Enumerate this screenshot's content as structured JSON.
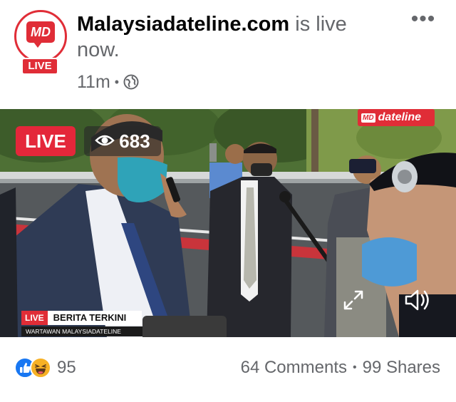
{
  "post": {
    "avatar_logo": "MD",
    "avatar_badge": "LIVE",
    "page_name": "Malaysiadateline.com",
    "status_text": "is live now.",
    "timestamp": "11m",
    "separator": "•",
    "audience_icon": "globe-icon",
    "more_label": "•••"
  },
  "video": {
    "live_label": "LIVE",
    "viewer_count": "683",
    "viewer_icon": "eye-icon",
    "watermark_logo": "MD",
    "watermark_text": "dateline",
    "lower_third": {
      "live": "LIVE",
      "title": "BERITA TERKINI",
      "subtitle": "WARTAWAN MALAYSIADATELINE"
    },
    "expand_icon": "expand-icon",
    "sound_icon": "speaker-icon"
  },
  "footer": {
    "reaction_icons": [
      "like-icon",
      "haha-icon"
    ],
    "reaction_count": "95",
    "comments": "64 Comments",
    "separator": "•",
    "shares": "99 Shares"
  },
  "colors": {
    "brand_red": "#e02d37",
    "live_red": "#e4273a",
    "like_blue": "#1877f2",
    "haha_yellow": "#f7b125",
    "meta_gray": "#65676b"
  }
}
